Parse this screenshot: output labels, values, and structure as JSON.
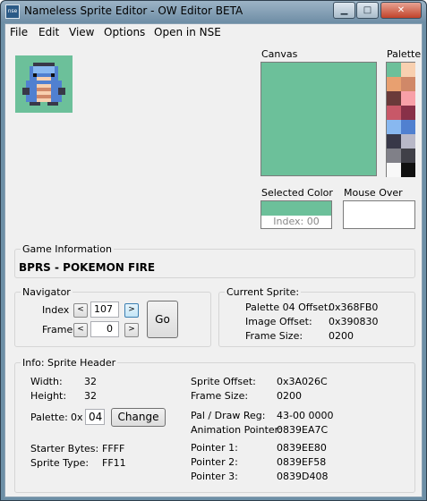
{
  "window": {
    "title": "Nameless Sprite Editor - OW Editor BETA",
    "icon_text": "nse",
    "minimize": "▁",
    "maximize": "□",
    "close": "✕"
  },
  "menu": [
    "File",
    "Edit",
    "View",
    "Options",
    "Open in NSE"
  ],
  "canvas": {
    "label": "Canvas",
    "color": "#6cc09a"
  },
  "palette": {
    "label": "Palette",
    "colors": [
      "#6cc09a",
      "#f8d0b0",
      "#e8a070",
      "#d08868",
      "#6a3a3a",
      "#f8a0a8",
      "#c85868",
      "#883048",
      "#88b8f0",
      "#5080d0",
      "#383848",
      "#b8b8c8",
      "#808088",
      "#404048",
      "#f8f8f8",
      "#101010"
    ]
  },
  "selected_color": {
    "label": "Selected Color",
    "index": "Index: 00"
  },
  "mouse_over": {
    "label": "Mouse Over"
  },
  "game_info": {
    "title": "Game Information",
    "name": "BPRS - POKEMON FIRE"
  },
  "navigator": {
    "title": "Navigator",
    "index_label": "Index",
    "index_value": "107",
    "frame_label": "Frame",
    "frame_value": "0",
    "prev": "<",
    "next": ">",
    "go": "Go"
  },
  "current_sprite": {
    "title": "Current Sprite:",
    "rows": [
      {
        "label": "Palette 04 Offset:",
        "value": "0x368FB0"
      },
      {
        "label": "Image Offset:",
        "value": "0x390830"
      },
      {
        "label": "Frame Size:",
        "value": "0200"
      }
    ]
  },
  "sprite_header": {
    "title": "Info: Sprite Header",
    "width_label": "Width:",
    "width": "32",
    "height_label": "Height:",
    "height": "32",
    "palette_label": "Palette:",
    "palette_prefix": "0x",
    "palette_value": "04",
    "change": "Change",
    "starter_label": "Starter Bytes:",
    "starter": "FFFF",
    "type_label": "Sprite Type:",
    "type": "FF11",
    "right": [
      {
        "label": "Sprite Offset:",
        "value": "0x3A026C"
      },
      {
        "label": "Frame Size:",
        "value": "0200"
      },
      {
        "label": "Pal / Draw Reg:",
        "value": "43-00 0000"
      },
      {
        "label": "Animation Pointer:",
        "value": "0839EA7C"
      },
      {
        "label": "Pointer 1:",
        "value": "0839EE80"
      },
      {
        "label": "Pointer 2:",
        "value": "0839EF58"
      },
      {
        "label": "Pointer 3:",
        "value": "0839D408"
      }
    ]
  }
}
